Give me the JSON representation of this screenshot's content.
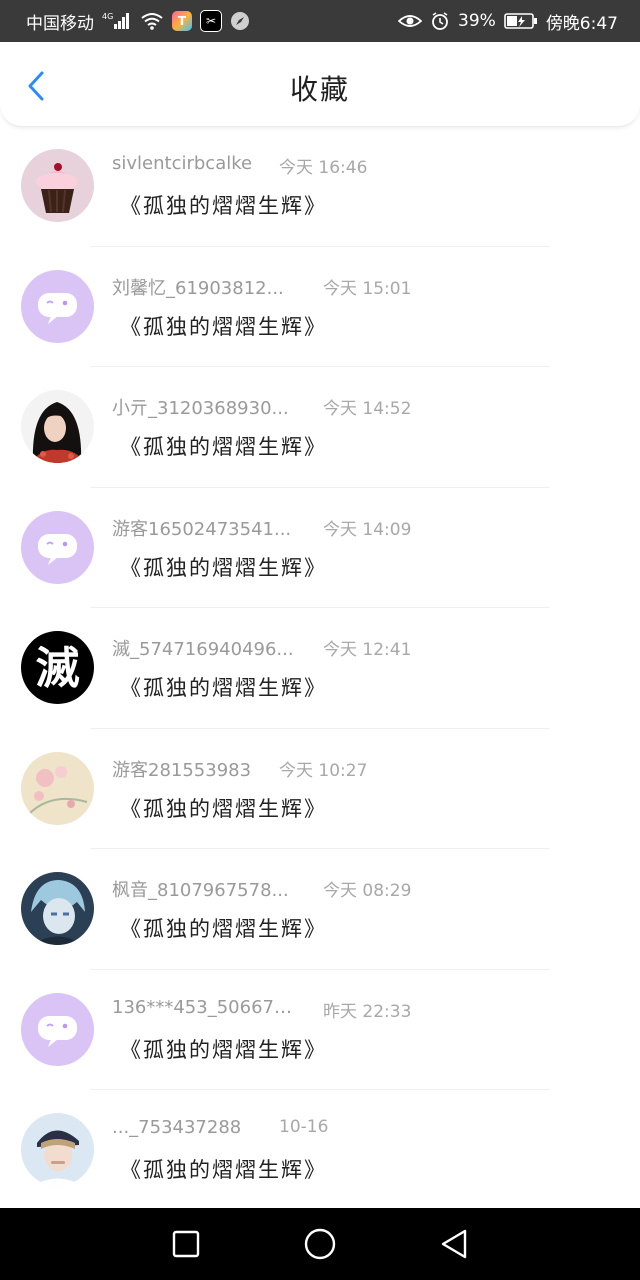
{
  "status_bar": {
    "carrier": "中国移动",
    "network": "4G",
    "eye_comfort": "eye-icon",
    "alarm": "alarm-icon",
    "battery_percent": "39%",
    "time": "傍晚6:47"
  },
  "header": {
    "title": "收藏",
    "back_icon": "chevron-left-icon"
  },
  "colors": {
    "accent_blue": "#2d8cf0",
    "default_avatar": "#d9c4f5"
  },
  "items": [
    {
      "name": "sivlentcirbcalke",
      "time": "今天 16:46",
      "message": "《孤独的熠熠生辉》",
      "avatar": "cupcake"
    },
    {
      "name": "刘馨忆_61903812...",
      "time": "今天 15:01",
      "message": "《孤独的熠熠生辉》",
      "avatar": "default"
    },
    {
      "name": "小亓_3120368930...",
      "time": "今天 14:52",
      "message": "《孤独的熠熠生辉》",
      "avatar": "woman"
    },
    {
      "name": "游客16502473541...",
      "time": "今天 14:09",
      "message": "《孤独的熠熠生辉》",
      "avatar": "default"
    },
    {
      "name": "滅_574716940496...",
      "time": "今天 12:41",
      "message": "《孤独的熠熠生辉》",
      "avatar": "mie"
    },
    {
      "name": "游客281553983",
      "time": "今天 10:27",
      "message": "《孤独的熠熠生辉》",
      "avatar": "flowers"
    },
    {
      "name": "枫音_8107967578...",
      "time": "今天 08:29",
      "message": "《孤独的熠熠生辉》",
      "avatar": "anime"
    },
    {
      "name": "136***453_506672...",
      "time": "昨天 22:33",
      "message": "《孤独的熠熠生辉》",
      "avatar": "default"
    },
    {
      "name": "..._753437288",
      "time": "10-16",
      "message": "《孤独的熠熠生辉》",
      "avatar": "boy"
    }
  ],
  "nav": {
    "recent": "square-icon",
    "home": "circle-icon",
    "back": "triangle-back-icon"
  }
}
